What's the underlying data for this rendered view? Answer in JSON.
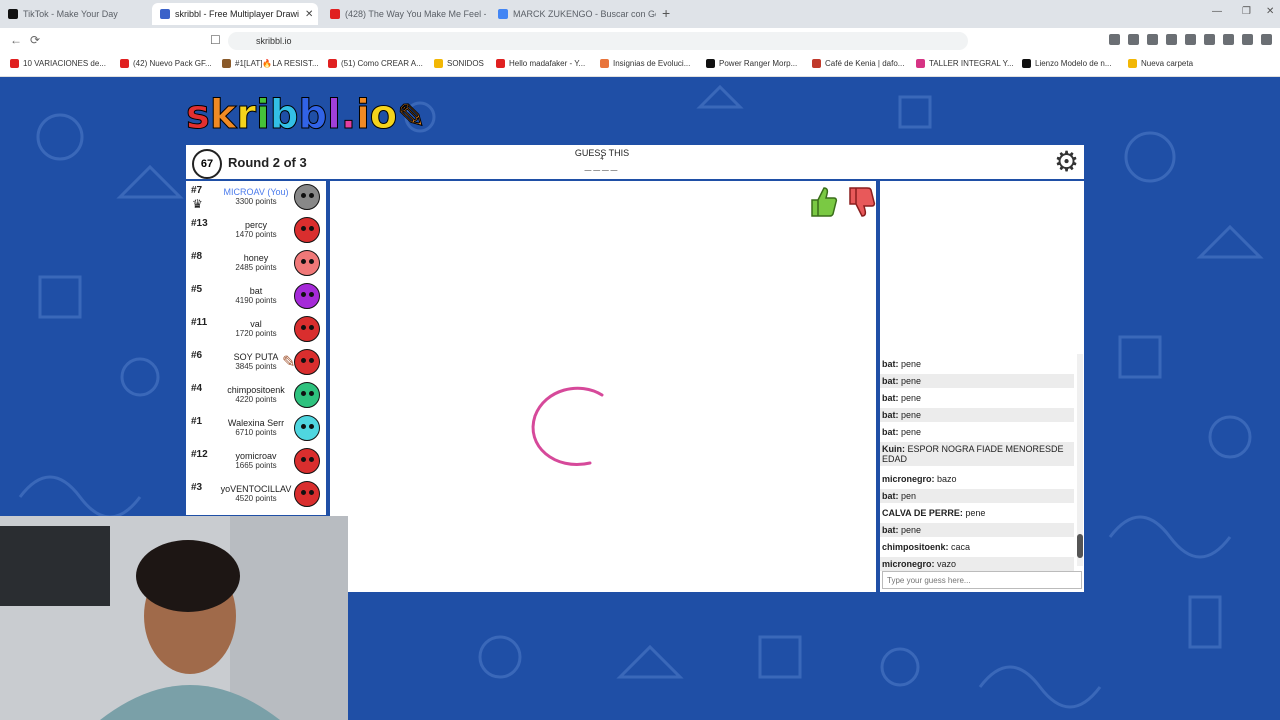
{
  "browser": {
    "tabs": [
      {
        "label": "TikTok - Make Your Day",
        "color": "#111111"
      },
      {
        "label": "skribbl - Free Multiplayer Drawi",
        "color": "#3b62c9",
        "active": true
      },
      {
        "label": "(428) The Way You Make Me Feel - ",
        "color": "#e02020"
      },
      {
        "label": "MARCK ZUKENGO - Buscar con Goo",
        "color": "#4285f4"
      }
    ],
    "url": "skribbl.io",
    "bookmarks": [
      {
        "label": "10 VARIACIONES de...",
        "color": "#e02020"
      },
      {
        "label": "(42) Nuevo Pack GF...",
        "color": "#e02020"
      },
      {
        "label": "#1[LAT]🔥LA RESIST...",
        "color": "#8a5a2a"
      },
      {
        "label": "(51) Como CREAR A...",
        "color": "#e02020"
      },
      {
        "label": "SONIDOS",
        "color": "#f2b705"
      },
      {
        "label": "Hello madafaker - Y...",
        "color": "#e02020"
      },
      {
        "label": "Insignias de Evoluci...",
        "color": "#e8743b"
      },
      {
        "label": "Power Ranger Morp...",
        "color": "#111111"
      },
      {
        "label": "Café de Kenia | dafo...",
        "color": "#c0392b"
      },
      {
        "label": "TALLER INTEGRAL Y...",
        "color": "#d63384"
      },
      {
        "label": "Lienzo Modelo de n...",
        "color": "#111111"
      },
      {
        "label": "Nueva carpeta",
        "color": "#f2b705"
      }
    ]
  },
  "game": {
    "logo": "skribbl.io",
    "timer": "67",
    "round": "Round 2 of 3",
    "guess_label": "GUESS THIS",
    "word_length": "4",
    "word_blanks": "____",
    "colors": {
      "background": "#1f4fa6",
      "you": "#4b7bec",
      "drawing": "#d6499a"
    }
  },
  "players": [
    {
      "rank": "#7",
      "name": "MICROAV (You)",
      "points": "3300 points",
      "you": true,
      "color": "#888888"
    },
    {
      "rank": "#13",
      "name": "percy",
      "points": "1470 points",
      "color": "#d92e2e"
    },
    {
      "rank": "#8",
      "name": "honey",
      "points": "2485 points",
      "color": "#f07878"
    },
    {
      "rank": "#5",
      "name": "bat",
      "points": "4190 points",
      "color": "#a52ad8"
    },
    {
      "rank": "#11",
      "name": "val",
      "points": "1720 points",
      "color": "#d92e2e"
    },
    {
      "rank": "#6",
      "name": "SOY PUTA",
      "points": "3845 points",
      "color": "#d92e2e"
    },
    {
      "rank": "#4",
      "name": "chimpositoenk",
      "points": "4220 points",
      "color": "#2ec27e"
    },
    {
      "rank": "#1",
      "name": "Walexina Serr",
      "points": "6710 points",
      "color": "#4fd6e0"
    },
    {
      "rank": "#12",
      "name": "yomicroav",
      "points": "1665 points",
      "color": "#d92e2e"
    },
    {
      "rank": "#3",
      "name": "yoVENTOCILLAV",
      "points": "4520 points",
      "color": "#d92e2e"
    }
  ],
  "bubbles": {
    "bat": "pene",
    "chimp": "caca",
    "partial": ":o"
  },
  "chat": [
    {
      "name": "bat:",
      "text": "pene"
    },
    {
      "name": "bat:",
      "text": "pene"
    },
    {
      "name": "bat:",
      "text": "pene"
    },
    {
      "name": "bat:",
      "text": "pene"
    },
    {
      "name": "bat:",
      "text": "pene"
    },
    {
      "name": "Kuin:",
      "text": "ESPOR NOGRA FIADE MENORESDE EDAD"
    },
    {
      "name": "micronegro:",
      "text": "bazo"
    },
    {
      "name": "bat:",
      "text": "pen"
    },
    {
      "name": "CALVA DE PERRE:",
      "text": "pene"
    },
    {
      "name": "bat:",
      "text": "pene"
    },
    {
      "name": "chimpositoenk:",
      "text": "caca"
    },
    {
      "name": "micronegro:",
      "text": "vazo"
    }
  ],
  "chat_input_placeholder": "Type your guess here..."
}
